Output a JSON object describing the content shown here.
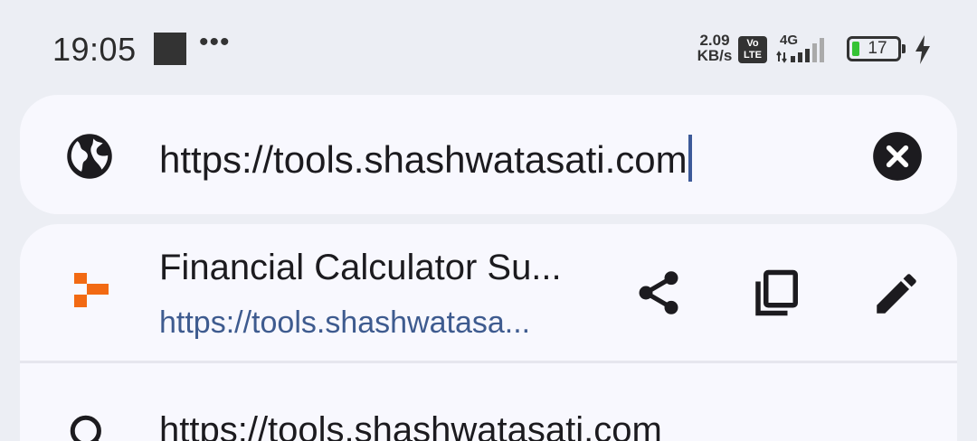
{
  "status_bar": {
    "time": "19:05",
    "more": "•••",
    "net_speed_value": "2.09",
    "net_speed_unit": "KB/s",
    "volte_top": "Vo",
    "volte_bottom": "LTE",
    "network_type": "4G",
    "battery_level": "17",
    "battery_fill_fraction": 0.17,
    "accent_battery": "#35c335"
  },
  "url_bar": {
    "value": "https://tools.shashwatasati.com",
    "left_icon": "globe-icon",
    "clear_icon": "clear-icon"
  },
  "suggestions": [
    {
      "title": "Financial Calculator Su...",
      "url": "https://tools.shashwatasa...",
      "site_icon_color": "#f26a13",
      "actions": [
        "share-icon",
        "copy-icon",
        "edit-icon"
      ]
    },
    {
      "icon": "search-icon",
      "text": "https://tools.shashwatasati.com"
    }
  ]
}
